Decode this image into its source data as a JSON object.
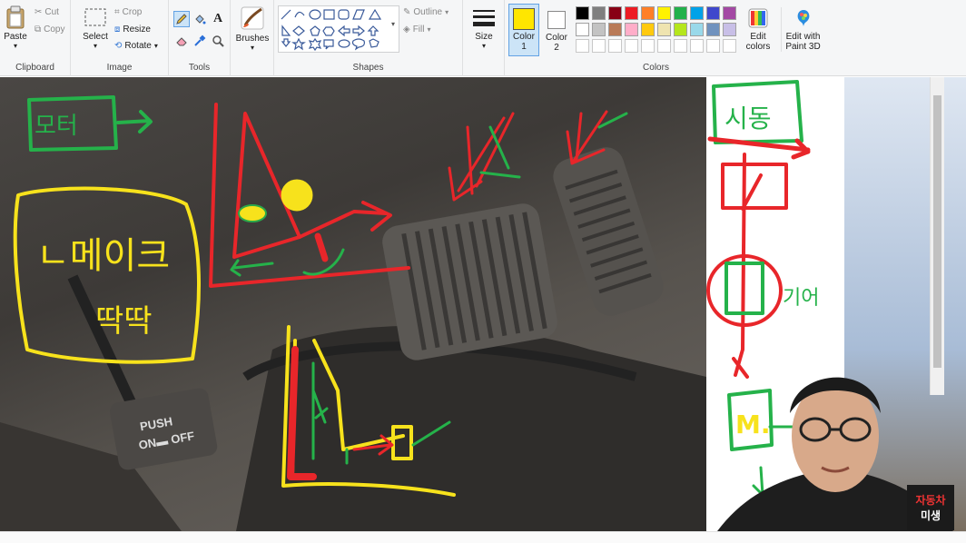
{
  "clipboard": {
    "paste": "Paste",
    "cut": "Cut",
    "copy": "Copy",
    "label": "Clipboard"
  },
  "image": {
    "select": "Select",
    "crop": "Crop",
    "resize": "Resize",
    "rotate": "Rotate",
    "label": "Image"
  },
  "tools": {
    "label": "Tools"
  },
  "brushes": {
    "label": "Brushes"
  },
  "shapes": {
    "outline": "Outline",
    "fill": "Fill",
    "label": "Shapes"
  },
  "size": {
    "label": "Size"
  },
  "color1": {
    "label": "Color",
    "num": "1",
    "value": "#ffe600"
  },
  "color2": {
    "label": "Color",
    "num": "2",
    "value": "#ffffff"
  },
  "colors": {
    "label": "Colors",
    "row1": [
      "#000000",
      "#7f7f7f",
      "#880015",
      "#ed1c24",
      "#ff7f27",
      "#fff200",
      "#22b14c",
      "#00a2e8",
      "#3f48cc",
      "#a349a4"
    ],
    "row2": [
      "#ffffff",
      "#c3c3c3",
      "#b97a57",
      "#ffaec9",
      "#ffc90e",
      "#efe4b0",
      "#b5e61d",
      "#99d9ea",
      "#7092be",
      "#c8bfe7"
    ]
  },
  "edit_colors": {
    "line1": "Edit",
    "line2": "colors"
  },
  "paint3d": {
    "line1": "Edit with",
    "line2": "Paint 3D"
  },
  "drawing": {
    "pedal_push": "PUSH",
    "pedal_onoff": "ON▬ OFF",
    "korean_brake": "ㄴ메이크",
    "korean_ttak": "딱딱",
    "korean_motor": "모터",
    "korean_side_top": "시동",
    "korean_side_mid": "기어",
    "side_m": "M."
  },
  "logo": {
    "line1": "자동차",
    "line2": "미생"
  }
}
